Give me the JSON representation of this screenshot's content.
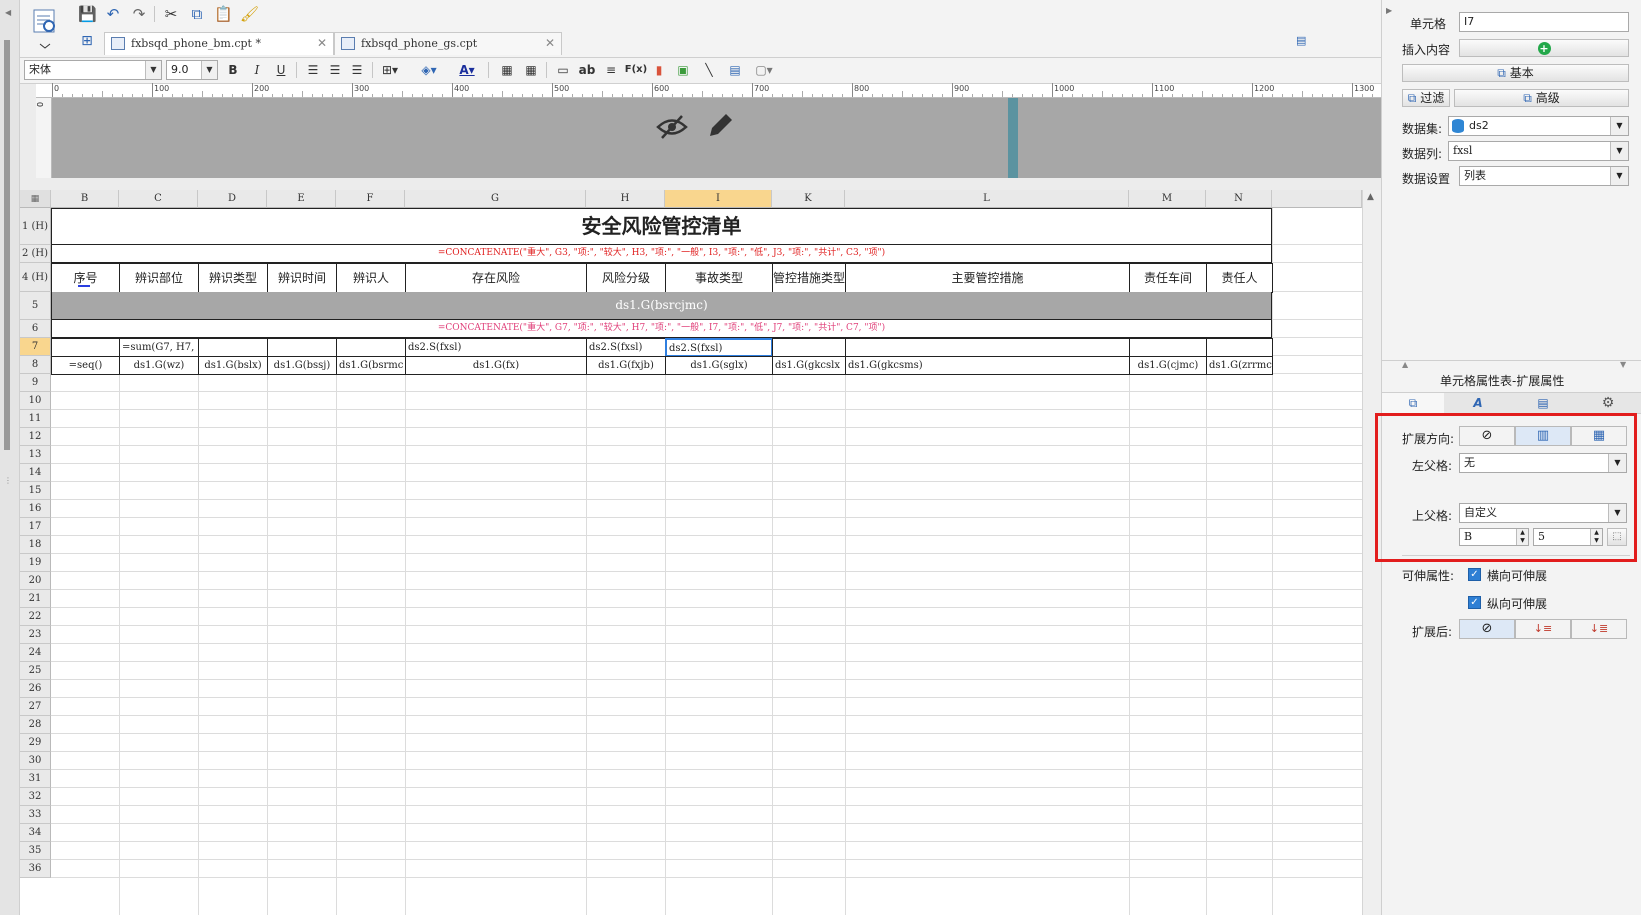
{
  "toolbar": {
    "icons": [
      "preview-icon",
      "save-icon",
      "undo-icon",
      "redo-icon",
      "cut-icon",
      "copy-icon",
      "paste-icon",
      "format-painter-icon"
    ]
  },
  "tabs": [
    {
      "label": "fxbsqd_phone_bm.cpt *",
      "close": "✕"
    },
    {
      "label": "fxbsqd_phone_gs.cpt",
      "close": "✕"
    }
  ],
  "format": {
    "font": "宋体",
    "size": "9.0",
    "bold": "B",
    "italic": "I",
    "underline": "U",
    "ab": "ab",
    "fx": "F(x)"
  },
  "ruler": {
    "labels": [
      "0",
      "100",
      "200",
      "300",
      "400",
      "500",
      "600",
      "700",
      "800",
      "900",
      "1000",
      "1100",
      "1200",
      "1300"
    ]
  },
  "sheet": {
    "columns": [
      "B",
      "C",
      "D",
      "E",
      "F",
      "G",
      "H",
      "I",
      "K",
      "L",
      "M",
      "N"
    ],
    "selected_column": "I",
    "row_labels": [
      "1 (H)",
      "2 (H)",
      "4 (H)",
      "5",
      "6",
      "7",
      "8",
      "9",
      "10",
      "11",
      "12",
      "13",
      "14",
      "15",
      "16",
      "17",
      "18",
      "19",
      "20",
      "21",
      "22",
      "23",
      "24",
      "25",
      "26",
      "27",
      "28",
      "29",
      "30",
      "31",
      "32",
      "33",
      "34",
      "35",
      "36"
    ],
    "selected_row": "7",
    "title": "安全风险管控清单",
    "formula_row2": "=CONCATENATE(\"重大\", G3, \"项:\", \"较大\", H3, \"项:\", \"一般\", I3, \"项:\", \"低\", J3, \"项:\", \"共计\", C3, \"项\")",
    "headers": [
      "序号",
      "辨识部位",
      "辨识类型",
      "辨识时间",
      "辨识人",
      "存在风险",
      "风险分级",
      "事故类型",
      "管控措施类型",
      "主要管控措施",
      "责任车间",
      "责任人"
    ],
    "group_row": "ds1.G(bsrcjmc)",
    "formula_row6": "=CONCATENATE(\"重大\", G7, \"项:\", \"较大\", H7, \"项:\", \"一般\", I7, \"项:\", \"低\", J7, \"项:\", \"共计\", C7, \"项\")",
    "row7": {
      "c": "=sum(G7, H7,",
      "g": "ds2.S(fxsl)",
      "h": "ds2.S(fxsl)",
      "i": "ds2.S(fxsl)"
    },
    "row8": [
      "=seq()",
      "ds1.G(wz)",
      "ds1.G(bslx)",
      "ds1.G(bssj)",
      "ds1.G(bsrmc",
      "ds1.G(fx)",
      "ds1.G(fxjb)",
      "ds1.G(sglx)",
      "ds1.G(gkcslx",
      "ds1.G(gkcsms)",
      "ds1.G(cjmc)",
      "ds1.G(zrrmc"
    ]
  },
  "panel": {
    "cell_label": "单元格",
    "cell_value": "I7",
    "insert_label": "插入内容",
    "basic_btn": "基本",
    "filter_btn": "过滤",
    "advanced_btn": "高级",
    "dataset_label": "数据集:",
    "dataset_value": "ds2",
    "column_label": "数据列:",
    "column_value": "fxsl",
    "setting_label": "数据设置",
    "setting_value": "列表",
    "props_title": "单元格属性表-扩展属性",
    "expand_dir_label": "扩展方向:",
    "left_parent_label": "左父格:",
    "left_parent_value": "无",
    "top_parent_label": "上父格:",
    "top_parent_value": "自定义",
    "top_col": "B",
    "top_row": "5",
    "stretch_label": "可伸属性:",
    "stretch_h": "横向可伸展",
    "stretch_v": "纵向可伸展",
    "after_label": "扩展后:"
  }
}
